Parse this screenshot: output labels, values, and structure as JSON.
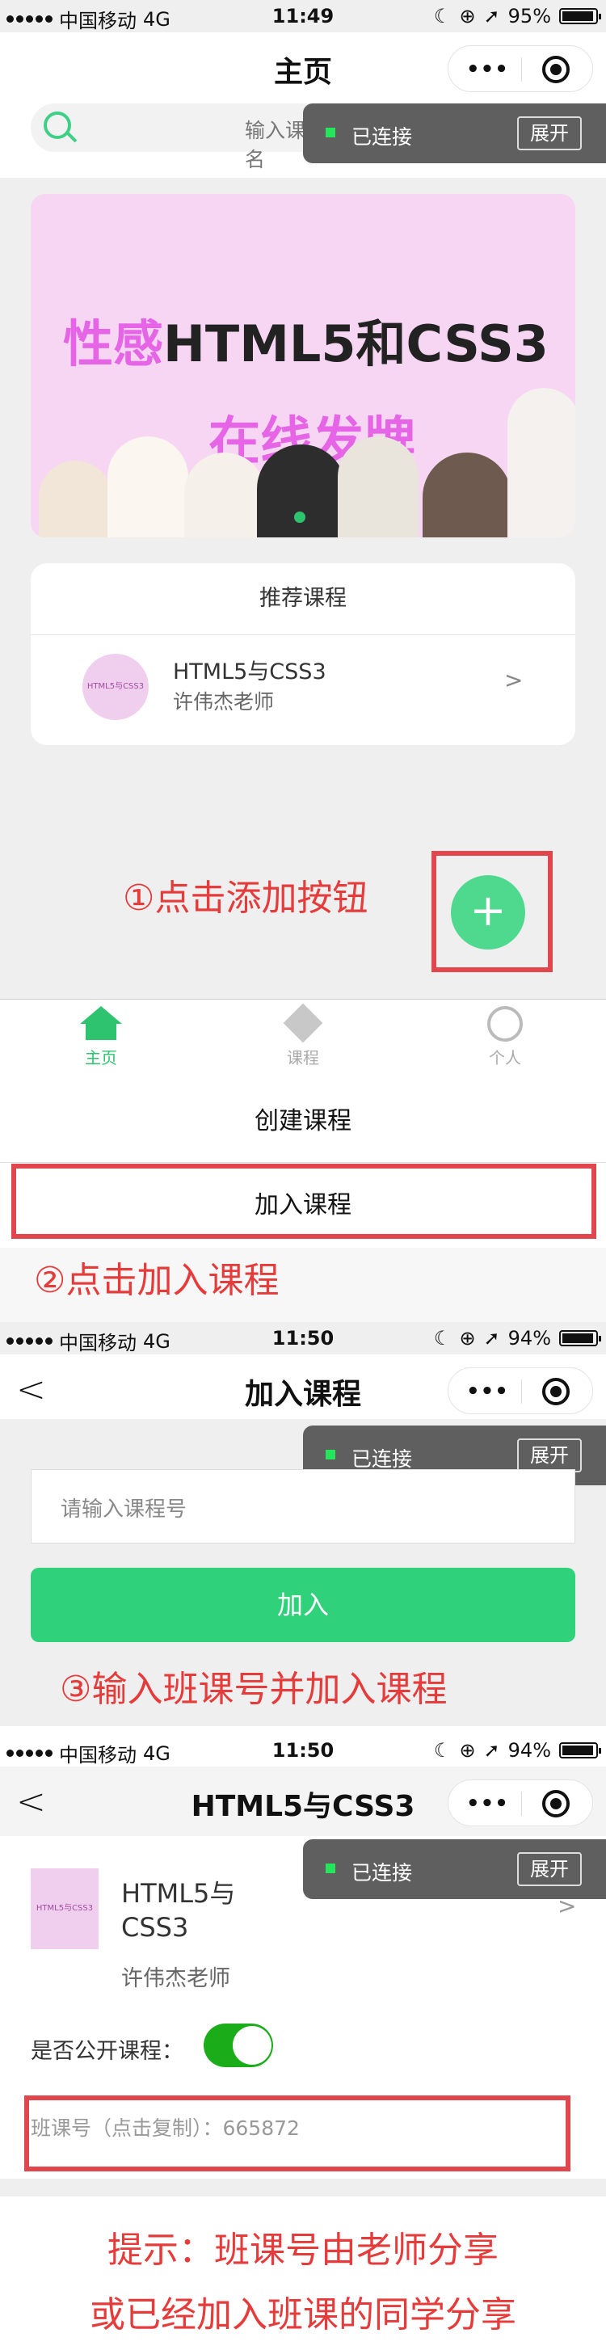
{
  "status1": {
    "carrier": "中国移动",
    "network": "4G",
    "time": "11:49",
    "battery": "95%",
    "battery_level": 0.95
  },
  "status2": {
    "carrier": "中国移动",
    "network": "4G",
    "time": "11:50",
    "battery": "94%",
    "battery_level": 0.94
  },
  "status3": {
    "carrier": "中国移动",
    "network": "4G",
    "time": "11:50",
    "battery": "94%",
    "battery_level": 0.94
  },
  "home": {
    "title": "主页",
    "search_placeholder": "输入课程名",
    "connected_label": "已连接",
    "expand_label": "展开",
    "banner_line1_a": "性感",
    "banner_line1_b": "HTML5和",
    "banner_line1_c": "CSS3",
    "banner_line2": "在线发牌",
    "recommend_title": "推荐课程",
    "course": {
      "name": "HTML5与CSS3",
      "teacher": "许伟杰老师",
      "thumb_text": "HTML5与CSS3"
    },
    "step1": "①点击添加按钮",
    "tabs": [
      {
        "label": "主页"
      },
      {
        "label": "课程"
      },
      {
        "label": "个人"
      }
    ]
  },
  "sheet": {
    "create_label": "创建课程",
    "join_label": "加入课程",
    "step2": "②点击加入课程"
  },
  "join": {
    "title": "加入课程",
    "input_placeholder": "请输入课程号",
    "join_button": "加入",
    "step3": "③输入班课号并加入课程",
    "connected_label": "已连接",
    "expand_label": "展开"
  },
  "course_page": {
    "title": "HTML5与CSS3",
    "name_line1": "HTML5与",
    "name_line2": "CSS3",
    "teacher": "许伟杰老师",
    "public_label": "是否公开课程：",
    "public_on": true,
    "class_code_label": "班课号（点击复制）：665872",
    "thumb_text": "HTML5与CSS3",
    "connected_label": "已连接",
    "expand_label": "展开"
  },
  "tip": {
    "line1": "提示：班课号由老师分享",
    "line2": "或已经加入班课的同学分享"
  },
  "colors": {
    "accent_green": "#4fd98f",
    "tab_active": "#2ec46f",
    "annotation_red": "#e63b3b",
    "switch_green": "#1aad19"
  }
}
